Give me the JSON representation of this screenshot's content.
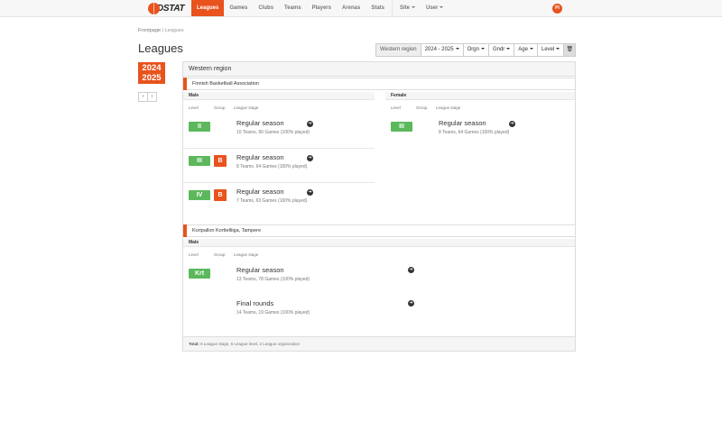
{
  "nav": {
    "logo_text": "DSTAT",
    "items": [
      {
        "label": "Leagues",
        "active": true
      },
      {
        "label": "Games"
      },
      {
        "label": "Clubs"
      },
      {
        "label": "Teams"
      },
      {
        "label": "Players"
      },
      {
        "label": "Arenas"
      },
      {
        "label": "Stats"
      }
    ],
    "site_label": "Site",
    "user_label": "User",
    "avatar_initials": "PI"
  },
  "breadcrumb": {
    "home": "Frontpage",
    "separator": " | ",
    "current": "Leagues"
  },
  "page_title": "Leagues",
  "filters": {
    "region": "Western region",
    "season": "2024 - 2025",
    "orgn": "Orgn",
    "gndr": "Gndr",
    "age": "Age",
    "level": "Level",
    "trash_icon": "🗑"
  },
  "season_badge": {
    "line1": "2024",
    "line2": "2025"
  },
  "season_nav": {
    "prev": "‹",
    "next": "›"
  },
  "panel": {
    "title": "Western region",
    "associations": [
      {
        "name": "Finnish Basketball Association",
        "male": {
          "label": "Male",
          "col_level": "Level",
          "col_group": "Group",
          "col_stage": "League stage",
          "rows": [
            {
              "level": "II",
              "group": "",
              "stage": "Regular season",
              "sub": "10 Teams, 90 Games (100% played)"
            },
            {
              "level": "III",
              "group": "B",
              "stage": "Regular season",
              "sub": "8 Teams, 64 Games (100% played)"
            },
            {
              "level": "IV",
              "group": "B",
              "stage": "Regular season",
              "sub": "7 Teams, 63 Games (100% played)"
            }
          ]
        },
        "female": {
          "label": "Female",
          "col_level": "Level",
          "col_group": "Group",
          "col_stage": "League stage",
          "rows": [
            {
              "level": "III",
              "group": "",
              "stage": "Regular season",
              "sub": "8 Teams, 64 Games (100% played)"
            }
          ]
        }
      },
      {
        "name": "Koripallon Korttelliiga, Tampere",
        "male": {
          "label": "Male",
          "col_level": "Level",
          "col_group": "Group",
          "col_stage": "League stage",
          "rows": [
            {
              "level": "Krt",
              "group": "",
              "stage": "Regular season",
              "sub": "13 Teams, 78 Games (100% played)"
            },
            {
              "level": "",
              "group": "",
              "stage": "Final rounds",
              "sub": "14 Teams, 19 Games (100% played)"
            }
          ]
        }
      }
    ],
    "footer_label": "Total:",
    "footer_text": " 6 League stage, 5 League level, 2 League organization"
  }
}
